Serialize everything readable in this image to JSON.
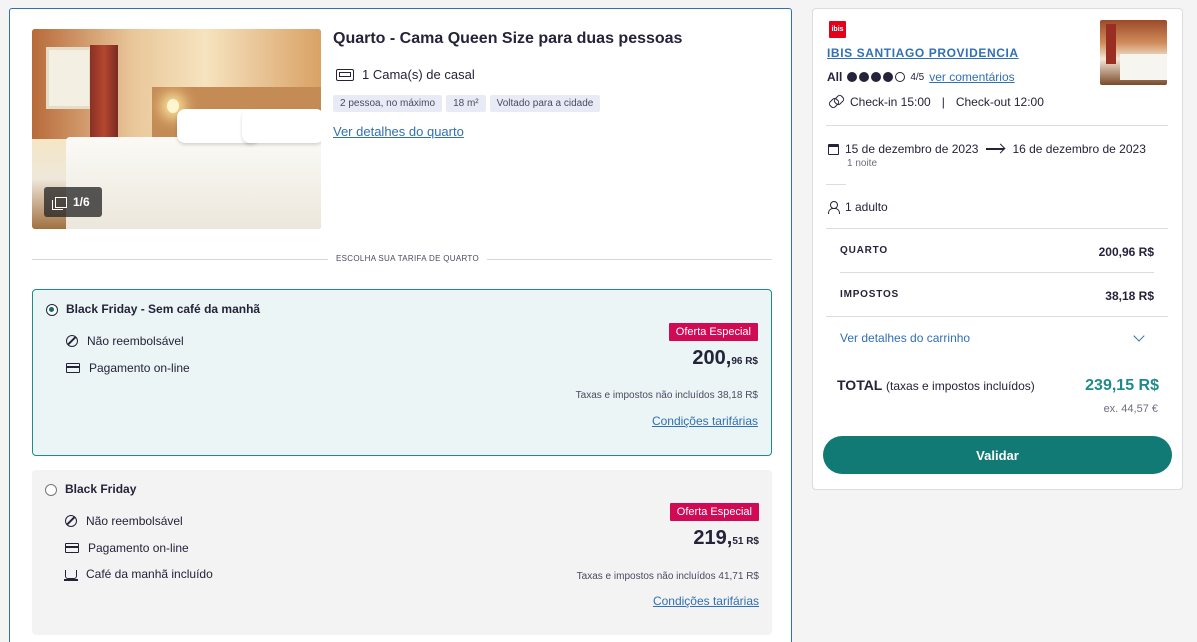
{
  "room": {
    "photo_counter": "1/6",
    "title": "Quarto - Cama Queen Size para duas pessoas",
    "bed": "1 Cama(s) de casal",
    "tags": [
      "2 pessoa, no máximo",
      "18 m²",
      "Voltado para a cidade"
    ],
    "details_link": "Ver detalhes do quarto"
  },
  "divider_label": "ESCOLHA SUA TARIFA DE QUARTO",
  "rates": [
    {
      "name": "Black Friday - Sem café da manhã",
      "selected": true,
      "features": [
        "Não reembolsável",
        "Pagamento on-line"
      ],
      "badge": "Oferta Especial",
      "price_main": "200,",
      "price_cents": "96 R$",
      "taxes": "Taxas e impostos não incluídos 38,18 R$",
      "conditions": "Condições tarifárias"
    },
    {
      "name": "Black Friday",
      "selected": false,
      "features": [
        "Não reembolsável",
        "Pagamento on-line",
        "Café da manhã incluído"
      ],
      "badge": "Oferta Especial",
      "price_main": "219,",
      "price_cents": "51 R$",
      "taxes": "Taxas e impostos não incluídos 41,71 R$",
      "conditions": "Condições tarifárias"
    }
  ],
  "summary": {
    "logo_text": "ibis",
    "hotel_name": "IBIS SANTIAGO PROVIDENCIA",
    "rating_brand": "All",
    "rating": 4,
    "rating_max": 5,
    "rating_text": "4/5",
    "reviews_link": "ver comentários",
    "checkin": "Check-in 15:00",
    "checkin_sep": "|",
    "checkout": "Check-out 12:00",
    "date_from": "15 de dezembro de 2023",
    "date_to": "16 de dezembro de 2023",
    "nights": "1 noite",
    "guests": "1 adulto",
    "room_label": "QUARTO",
    "room_value": "200,96 R$",
    "tax_label": "IMPOSTOS",
    "tax_value": "38,18 R$",
    "cart_link": "Ver detalhes do carrinho",
    "total_label": "TOTAL",
    "total_note": "(taxas e impostos incluídos)",
    "total_value": "239,15 R$",
    "ex_value": "ex. 44,57 €",
    "validate": "Validar"
  },
  "colors": {
    "teal": "#127a74",
    "link": "#3070b3",
    "badge": "#d10a56"
  }
}
